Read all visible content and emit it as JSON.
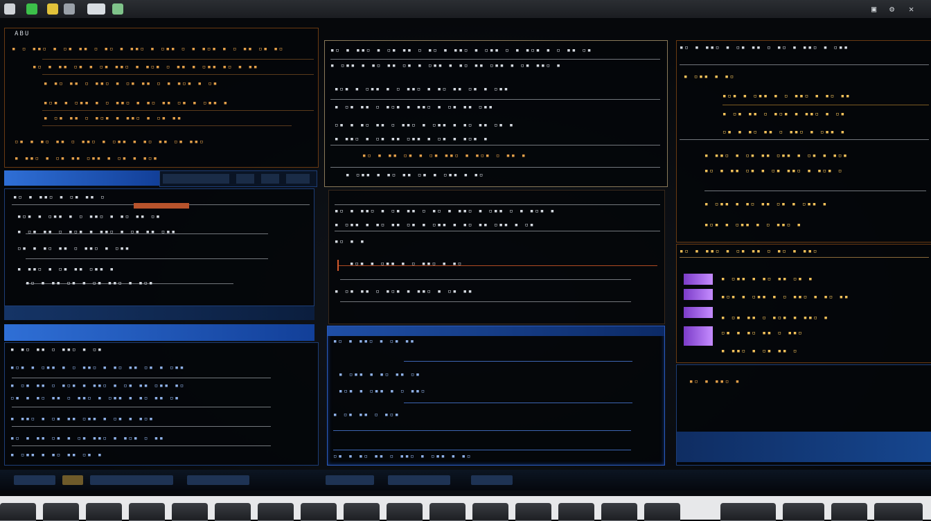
{
  "window": {
    "title": ""
  },
  "colors": {
    "accent_blue": "#2f6fd6",
    "accent_orange": "#e3a04a",
    "accent_purple": "#8a4ad8",
    "background": "#07090d"
  },
  "topbar_icons": [
    "app-icon",
    "green-icon",
    "yellow-icon",
    "gear-icon",
    "folder-icon",
    "cloud-icon"
  ],
  "panels": {
    "left_top": {
      "title": "ABU"
    },
    "left_mid": {
      "header": ""
    },
    "left_bottom": {
      "header": ""
    },
    "center_top": {},
    "center_mid": {},
    "center_bottom": {
      "header": ""
    },
    "right_top": {},
    "right_mid": {},
    "right_bottom": {}
  }
}
